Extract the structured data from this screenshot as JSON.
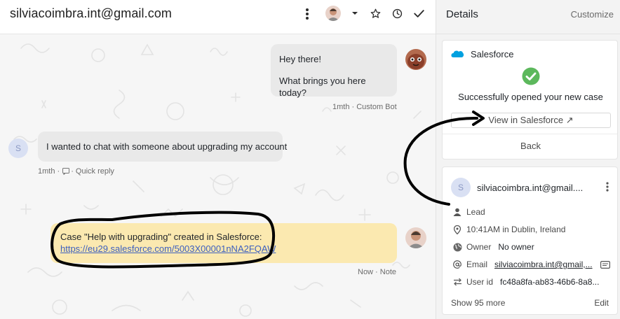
{
  "conversation": {
    "title": "silviacoimbra.int@gmail.com",
    "messages": {
      "bot": {
        "line1": "Hey there!",
        "line2": "What brings you here today?",
        "meta": "1mth · Custom Bot"
      },
      "user": {
        "avatar_initial": "S",
        "text": "I wanted to chat with someone about upgrading my account",
        "meta_time": "1mth ·",
        "meta_action": "· Quick reply"
      },
      "note": {
        "line1": "Case \"Help with upgrading\" created in Salesforce:",
        "link": "https://eu29.salesforce.com/5003X00001nNA2FQAW",
        "meta": "Now · Note"
      }
    }
  },
  "details": {
    "title": "Details",
    "customize_label": "Customize",
    "salesforce": {
      "name": "Salesforce",
      "message": "Successfully opened your new case",
      "view_button": "View in Salesforce ↗",
      "back_button": "Back"
    },
    "lead": {
      "avatar_initial": "S",
      "email": "silviacoimbra.int@gmail....",
      "type": "Lead",
      "location": "10:41AM in Dublin, Ireland",
      "owner_label": "Owner",
      "owner_value": "No owner",
      "email_label": "Email",
      "email_value": "silviacoimbra.int@gmail,...",
      "userid_label": "User id",
      "userid_value": "fc48a8fa-ab83-46b6-8a8...",
      "show_more": "Show 95 more",
      "edit": "Edit"
    }
  },
  "colors": {
    "note_background": "#fbe9b0",
    "link": "#3c5fbf",
    "success": "#5cb85c",
    "salesforce_blue": "#00a1e0"
  },
  "icons": [
    "more-vertical-icon",
    "chevron-down-icon",
    "star-icon",
    "clock-icon",
    "check-icon",
    "salesforce-cloud-icon",
    "success-check-icon",
    "person-icon",
    "location-icon",
    "globe-icon",
    "at-icon",
    "id-card-icon",
    "transfer-icon"
  ]
}
